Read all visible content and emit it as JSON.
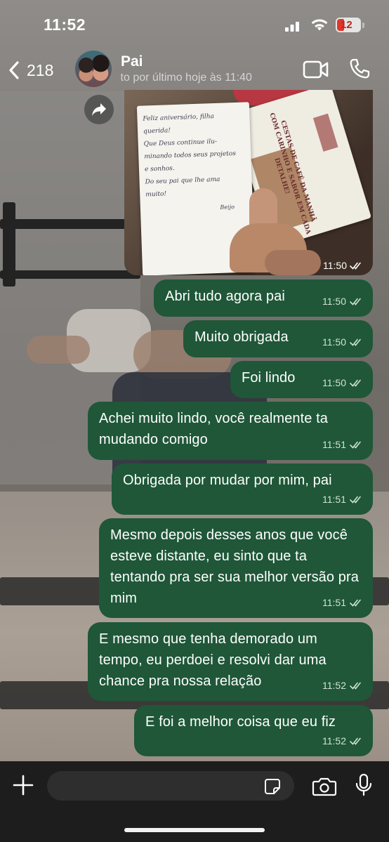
{
  "status_bar": {
    "time": "11:52",
    "battery": "12",
    "battery_color": "#e0362b"
  },
  "header": {
    "back_count": "218",
    "contact_name": "Pai",
    "last_seen": "visto por último hoje às 11:40"
  },
  "image_message": {
    "time": "11:50",
    "handwritten_lines": [
      "Feliz aniversário, filha",
      "querida!",
      "Que Deus continue ilu-",
      "minando todos seus projetos",
      "e sonhos.",
      "Do seu pai que lhe ama",
      "muito!"
    ],
    "signature": "Beijo",
    "printed_card_lines": [
      "CESTAS DE CAFÉ DA MANHÃ",
      "COM CARINHO E SABOR EM CADA DETALHE!"
    ]
  },
  "messages": [
    {
      "text": "Abri tudo agora pai",
      "time": "11:50"
    },
    {
      "text": "Muito obrigada",
      "time": "11:50"
    },
    {
      "text": "Foi lindo",
      "time": "11:50"
    },
    {
      "text": "Achei muito lindo, você realmente ta mudando comigo",
      "time": "11:51"
    },
    {
      "text": "Obrigada por mudar por mim, pai",
      "time": "11:51"
    },
    {
      "text": "Mesmo depois desses anos que você esteve distante, eu sinto que ta tentando pra ser sua melhor versão pra mim",
      "time": "11:51"
    },
    {
      "text": "E mesmo que tenha demorado um tempo, eu perdoei e resolvi dar uma chance pra nossa relação",
      "time": "11:52"
    },
    {
      "text": "E foi a melhor coisa que eu fiz",
      "time": "11:52"
    }
  ],
  "composer": {
    "input_value": "",
    "input_placeholder": ""
  },
  "colors": {
    "bubble_outgoing": "#1f5738",
    "read_ticks": "#cfe2d6"
  },
  "icons": [
    "chevron-left-icon",
    "video-camera-icon",
    "phone-icon",
    "forward-icon",
    "plus-icon",
    "sticker-icon",
    "camera-icon",
    "microphone-icon",
    "read-ticks-icon"
  ]
}
